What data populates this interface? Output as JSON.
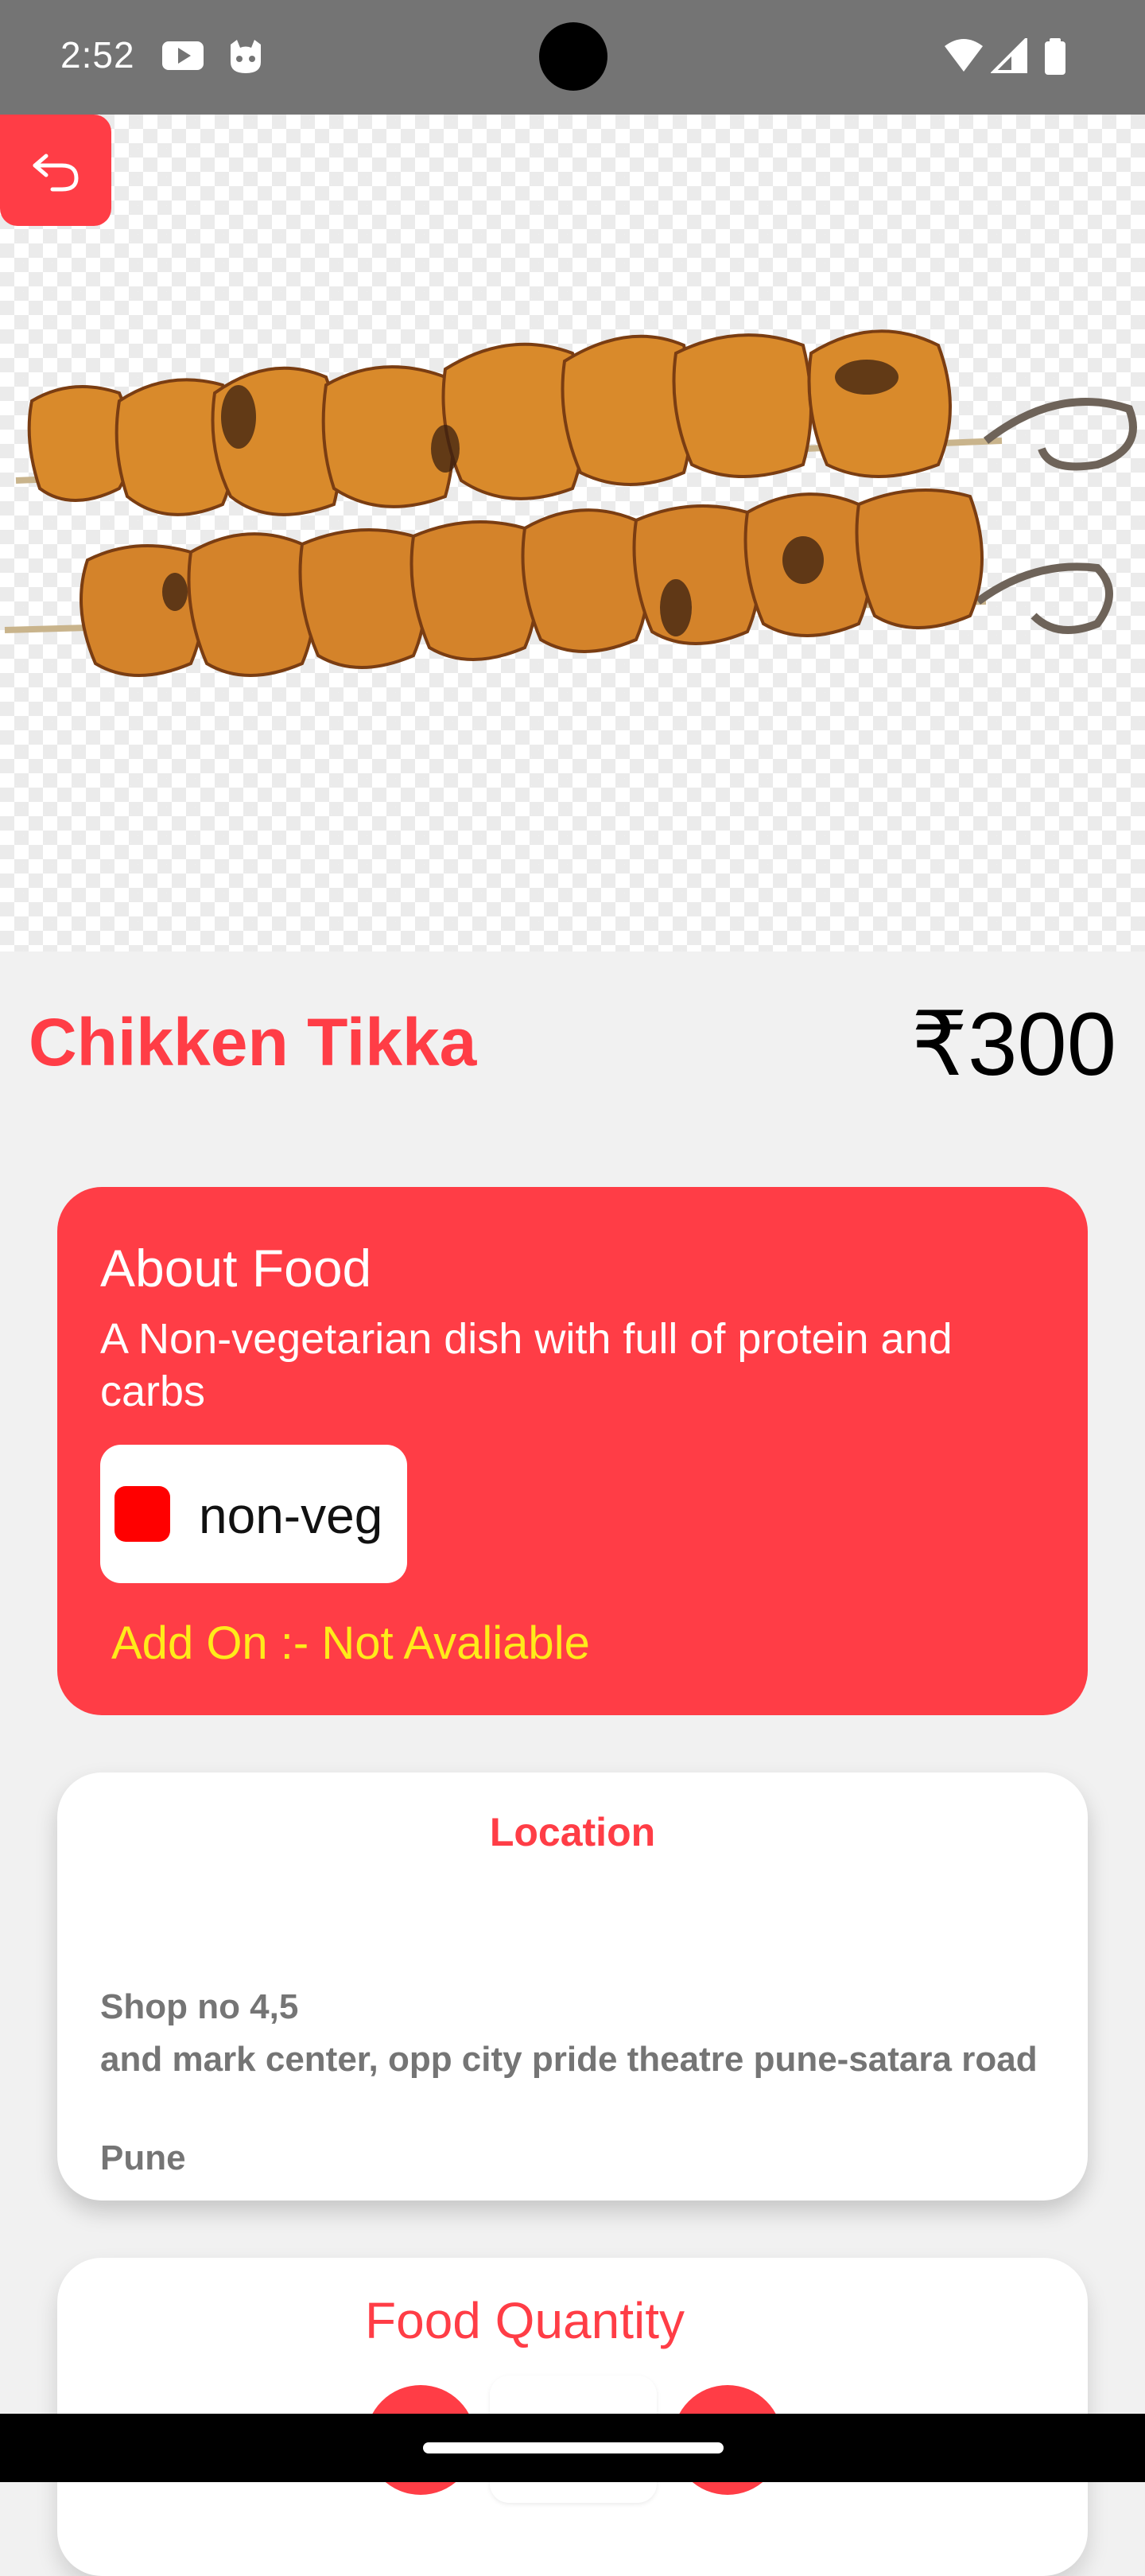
{
  "status_bar": {
    "time": "2:52",
    "icons": [
      "youtube-icon",
      "cat-face-icon",
      "wifi-icon",
      "signal-icon",
      "battery-icon"
    ]
  },
  "hero": {
    "image": "chicken-tikka-skewers"
  },
  "food": {
    "name": "Chikken Tikka",
    "price": "₹300"
  },
  "about": {
    "heading": "About Food",
    "description": "A Non-vegetarian dish with full of protein and carbs",
    "tag": "non-veg",
    "addon": "Add On :- Not Avaliable"
  },
  "location": {
    "heading": "Location",
    "line1": "Shop no 4,5",
    "line2": "and mark center, opp city pride theatre pune-satara road",
    "line3": "Pune"
  },
  "quantity": {
    "heading": "Food Quantity"
  },
  "colors": {
    "accent": "#ff3d46",
    "addon_text": "#ffeb1a",
    "nonveg_marker": "#ff0000"
  }
}
